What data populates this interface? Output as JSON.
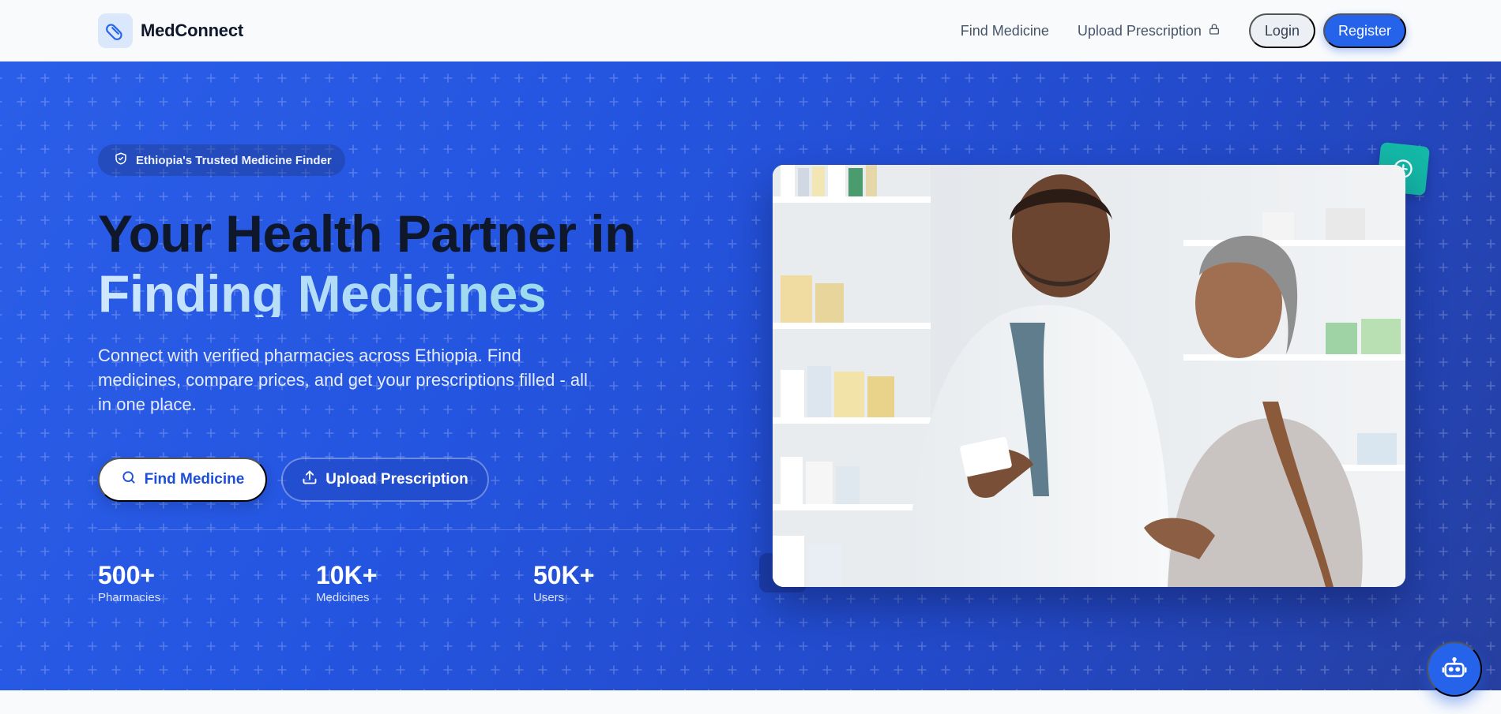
{
  "brand": {
    "name": "MedConnect",
    "logo_icon": "pill-icon"
  },
  "nav": {
    "links": [
      {
        "label": "Find Medicine"
      },
      {
        "label": "Upload Prescription",
        "icon": "lock-icon"
      }
    ],
    "login_label": "Login",
    "register_label": "Register"
  },
  "hero": {
    "badge": "Ethiopia's Trusted Medicine Finder",
    "badge_icon": "shield-check-icon",
    "headline_line1": "Your Health Partner in",
    "headline_line2": "Finding Medicines",
    "subtext": "Connect with verified pharmacies across Ethiopia. Find medicines, compare prices, and get your prescriptions filled - all in one place.",
    "primary_button": {
      "label": "Find Medicine",
      "icon": "search-icon"
    },
    "secondary_button": {
      "label": "Upload Prescription",
      "icon": "upload-icon"
    },
    "stats": [
      {
        "value": "500+",
        "label": "Pharmacies"
      },
      {
        "value": "10K+",
        "label": "Medicines"
      },
      {
        "value": "50K+",
        "label": "Users"
      }
    ],
    "image_alt": "Pharmacist helping a customer",
    "tag_icon": "plus-circle-icon"
  },
  "assistant": {
    "icon": "robot-icon"
  },
  "colors": {
    "primary": "#2563eb",
    "hero_start": "#2b5ee8",
    "hero_end": "#263f9f",
    "accent_teal": "#14b8a6",
    "headline_dark": "#0f172a"
  }
}
